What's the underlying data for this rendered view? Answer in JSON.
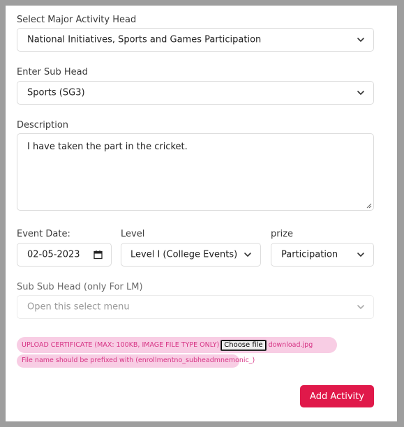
{
  "form": {
    "major_head": {
      "label": "Select Major Activity Head",
      "value": "National Initiatives, Sports and Games Participation"
    },
    "sub_head": {
      "label": "Enter Sub Head",
      "value": "Sports (SG3)"
    },
    "description": {
      "label": "Description",
      "value": "I have taken the part in the cricket."
    },
    "event_date": {
      "label": "Event Date:",
      "value": "02-05-2023"
    },
    "level": {
      "label": "Level",
      "value": "Level I (College Events)"
    },
    "prize": {
      "label": "prize",
      "value": "Participation"
    },
    "sub_sub_head": {
      "label": "Sub Sub Head (only For LM)",
      "placeholder": "Open this select menu"
    },
    "upload": {
      "label": "UPLOAD CERTIFICATE (MAX: 100KB, IMAGE FILE TYPE ONLY)",
      "choose_label": "Choose file",
      "file_name": "download.jpg",
      "hint": "File name should be prefixed with (enrollmentno_subheadmnemonic_)"
    },
    "submit_label": "Add Activity"
  },
  "colors": {
    "accent": "#e0194a",
    "pill_bg": "#f8cde4",
    "pill_text": "#d63384",
    "backdrop": "#9e9e9e"
  },
  "icons": {
    "select": "chevron-down-icon",
    "date": "calendar-icon",
    "resize": "resize-grip-icon"
  }
}
